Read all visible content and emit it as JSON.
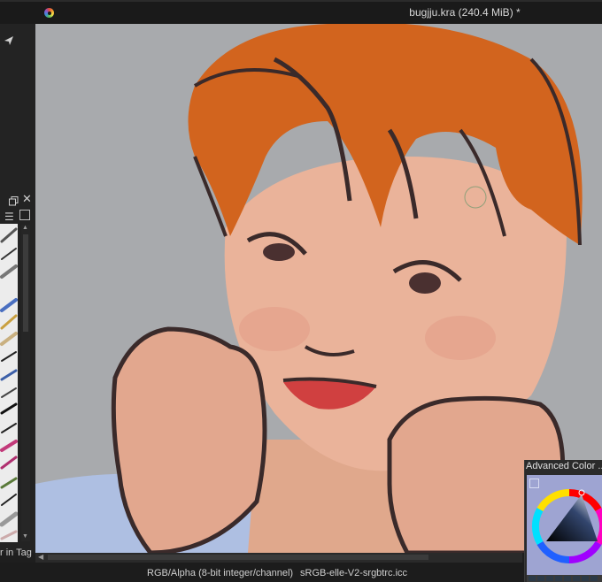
{
  "window": {
    "title": "bugjju.kra (240.4 MiB) *"
  },
  "brush_panel": {
    "tag_label": "r in Tag"
  },
  "status": {
    "color_model": "RGB/Alpha (8-bit integer/channel)",
    "profile": "sRGB-elle-V2-srgbtrc.icc"
  },
  "color_selector": {
    "title": "Advanced Color ...",
    "hue_ring": "rainbow",
    "triangle_color": "#33466e"
  },
  "colors": {
    "canvas_bg": "#a8aaad",
    "hair": "#d2641e",
    "skin": "#eab39a",
    "lips": "#d04040",
    "shirt": "#aebfe2",
    "line": "#3a2a2a"
  },
  "icons": [
    "krita-tab-icon",
    "share-icon",
    "float-icon",
    "close-icon",
    "menu-icon",
    "view-icon"
  ]
}
